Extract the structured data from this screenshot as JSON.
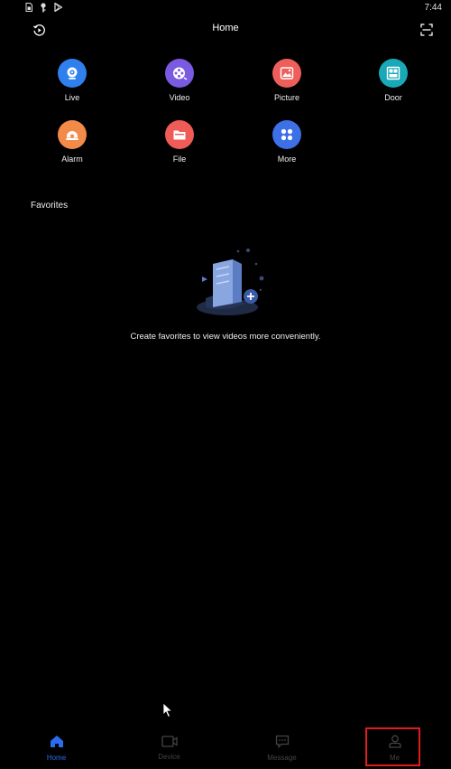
{
  "status_bar": {
    "time": "7:44",
    "icons": [
      "sim-icon",
      "key-icon",
      "play-store-icon"
    ]
  },
  "header": {
    "title": "Home",
    "left_icon": "playback-history-icon",
    "right_icon": "scan-icon"
  },
  "quick_access": [
    {
      "label": "Live",
      "icon": "camera-icon",
      "color": "#2f80ed"
    },
    {
      "label": "Video",
      "icon": "film-reel-icon",
      "color": "#7a5ae0"
    },
    {
      "label": "Picture",
      "icon": "picture-icon",
      "color": "#ee5f5b"
    },
    {
      "label": "Door",
      "icon": "door-icon",
      "color": "#18a8b8"
    },
    {
      "label": "Alarm",
      "icon": "alarm-icon",
      "color": "#f28a4a"
    },
    {
      "label": "File",
      "icon": "folder-icon",
      "color": "#ef5b57"
    },
    {
      "label": "More",
      "icon": "more-grid-icon",
      "color": "#3d6fe6"
    }
  ],
  "favorites": {
    "title": "Favorites",
    "empty_message": "Create favorites to view videos more conveniently."
  },
  "bottom_nav": {
    "active": "Home",
    "items": [
      {
        "label": "Home",
        "icon": "home-icon"
      },
      {
        "label": "Device",
        "icon": "device-icon"
      },
      {
        "label": "Message",
        "icon": "message-icon"
      },
      {
        "label": "Me",
        "icon": "user-icon"
      }
    ]
  },
  "colors": {
    "background": "#000000",
    "accent": "#2a6cf0",
    "highlight": "#e01d1d"
  }
}
